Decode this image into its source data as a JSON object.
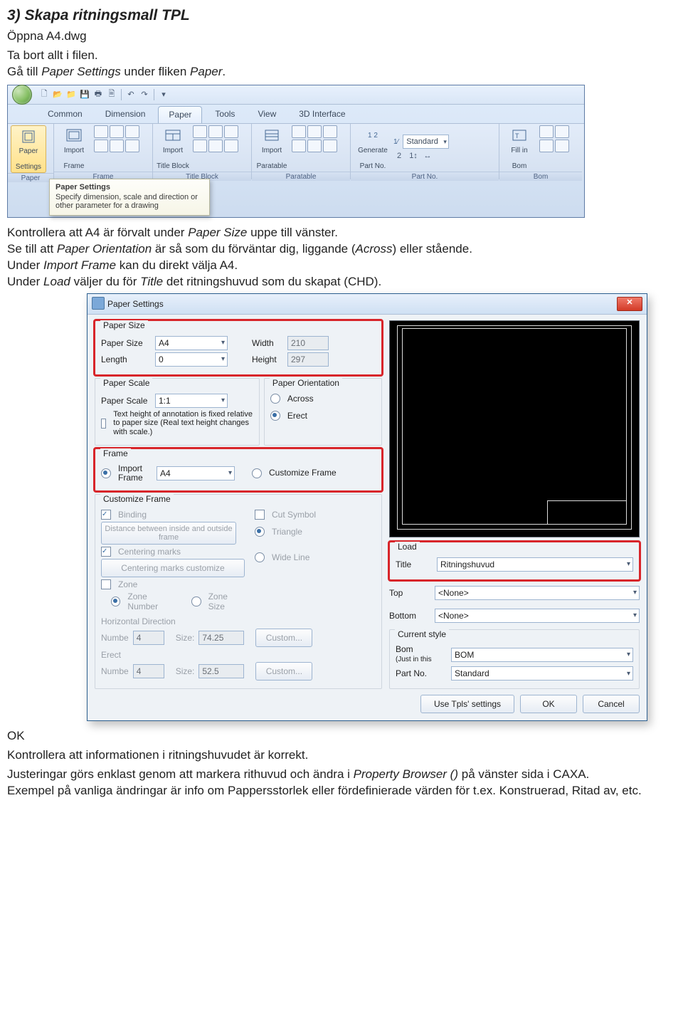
{
  "heading": "3) Skapa ritningsmall TPL",
  "intro1": "Öppna A4.dwg",
  "intro2": "Ta bort allt i filen.",
  "intro3_pre": "Gå till ",
  "intro3_i1": "Paper Settings",
  "intro3_mid": " under fliken ",
  "intro3_i2": "Paper",
  "intro3_end": ".",
  "ribbon": {
    "tabs": [
      "Common",
      "Dimension",
      "Paper",
      "Tools",
      "View",
      "3D Interface"
    ],
    "group_labels": [
      "Paper",
      "Frame",
      "Title Block",
      "Paratable",
      "Part No.",
      "Bom"
    ],
    "btn_paper_settings1": "Paper",
    "btn_paper_settings2": "Settings",
    "btn_import_frame1": "Import",
    "btn_import_frame2": "Frame",
    "btn_import_tb1": "Import",
    "btn_import_tb2": "Title Block",
    "btn_import_pt1": "Import",
    "btn_import_pt2": "Paratable",
    "btn_gen_pn1": "Generate",
    "btn_gen_pn2": "Part No.",
    "std_combo": "Standard",
    "btn_fill_bom1": "Fill in",
    "btn_fill_bom2": "Bom",
    "tooltip_title": "Paper Settings",
    "tooltip_body": "Specify dimension, scale and direction or other parameter for a drawing"
  },
  "mid1_pre": "Kontrollera att A4 är förvalt under ",
  "mid1_i1": "Paper Size",
  "mid1_end": " uppe till vänster.",
  "mid2_pre": "Se till att ",
  "mid2_i1": "Paper Orientation",
  "mid2_mid": " är så som du förväntar dig, liggande (",
  "mid2_i2": "Across",
  "mid2_end": ") eller stående.",
  "mid3_pre": "Under ",
  "mid3_i1": "Import Frame",
  "mid3_end": " kan du direkt välja A4.",
  "mid4_pre": "Under ",
  "mid4_i1": "Load",
  "mid4_mid": " väljer du för ",
  "mid4_i2": "Title",
  "mid4_end": " det ritningshuvud som du skapat (CHD).",
  "dialog": {
    "title": "Paper Settings",
    "paper_size_grp": "Paper Size",
    "paper_size_lbl": "Paper Size",
    "paper_size_val": "A4",
    "width_lbl": "Width",
    "width_val": "210",
    "length_lbl": "Length",
    "length_val": "0",
    "height_lbl": "Height",
    "height_val": "297",
    "scale_grp": "Paper Scale",
    "scale_lbl": "Paper Scale",
    "scale_val": "1:1",
    "scale_note": "Text height of annotation is fixed relative to paper size (Real text height changes with scale.)",
    "orient_grp": "Paper Orientation",
    "orient_across": "Across",
    "orient_erect": "Erect",
    "frame_grp": "Frame",
    "import_frame": "Import Frame",
    "import_frame_val": "A4",
    "customize_frame": "Customize Frame",
    "cust_grp": "Customize Frame",
    "binding": "Binding",
    "cut_symbol": "Cut Symbol",
    "dist_btn": "Distance between inside and outside frame",
    "triangle": "Triangle",
    "centering": "Centering marks",
    "centering_btn": "Centering marks customize",
    "wide_line": "Wide Line",
    "zone": "Zone",
    "zone_number": "Zone Number",
    "zone_size": "Zone Size",
    "hdir": "Horizontal Direction",
    "number_lbl": "Numbe",
    "hnum": "4",
    "size_lbl": "Size:",
    "hsize": "74.25",
    "custom_btn": "Custom...",
    "erect_lbl": "Erect",
    "vnum": "4",
    "vsize": "52.5",
    "load_grp": "Load",
    "title_lbl": "Title",
    "title_val": "Ritningshuvud",
    "top_lbl": "Top",
    "top_val": "<None>",
    "bottom_lbl": "Bottom",
    "bottom_val": "<None>",
    "cstyle_grp": "Current style",
    "bom_lbl": "Bom",
    "bom_hint": "(Just in this",
    "bom_val": "BOM",
    "pn_lbl": "Part No.",
    "pn_val": "Standard",
    "footer_tpl": "Use Tpls' settings",
    "footer_ok": "OK",
    "footer_cancel": "Cancel"
  },
  "ok_line": "OK",
  "out1": "Kontrollera att informationen i ritningshuvudet är korrekt.",
  "out2_pre": "Justeringar görs enklast genom att markera rithuvud och ändra i ",
  "out2_i1": "Property Browser ()",
  "out2_end": " på vänster sida i CAXA.",
  "out3": "Exempel på vanliga ändringar är info om Pappersstorlek eller fördefinierade värden för t.ex. Konstruerad, Ritad av, etc."
}
